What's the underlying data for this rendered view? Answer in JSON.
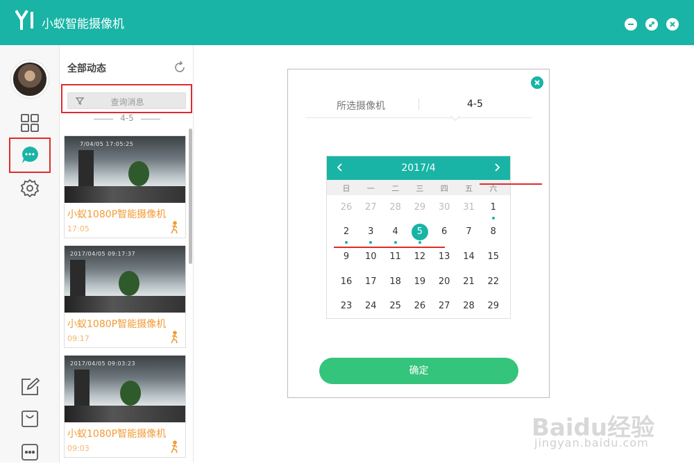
{
  "app": {
    "logo_text": "YI",
    "title": "小蚁智能摄像机"
  },
  "window": {
    "minimize": "minimize-icon",
    "restore": "restore-icon",
    "close": "close-icon"
  },
  "nav": {
    "items": [
      "grid-icon",
      "message-icon",
      "gear-icon",
      "edit-icon",
      "bag-icon",
      "more-icon"
    ]
  },
  "feed": {
    "title": "全部动态",
    "search_placeholder": "查询消息",
    "date_label": "4-5",
    "cards": [
      {
        "timestamp": "7/04/05 17:05:25",
        "name": "小蚁1080P智能摄像机",
        "time": "17:05"
      },
      {
        "timestamp": "2017/04/05 09:17:37",
        "name": "小蚁1080P智能摄像机",
        "time": "09:17"
      },
      {
        "timestamp": "2017/04/05 09:03:23",
        "name": "小蚁1080P智能摄像机",
        "time": "09:03"
      }
    ]
  },
  "dialog": {
    "tab_camera": "所选摄像机",
    "tab_date": "4-5",
    "month": "2017/4",
    "weekdays": [
      "日",
      "一",
      "二",
      "三",
      "四",
      "五",
      "六"
    ],
    "weeks": [
      [
        "26",
        "27",
        "28",
        "29",
        "30",
        "31",
        "1"
      ],
      [
        "2",
        "3",
        "4",
        "5",
        "6",
        "7",
        "8"
      ],
      [
        "9",
        "10",
        "11",
        "12",
        "13",
        "14",
        "15"
      ],
      [
        "16",
        "17",
        "18",
        "19",
        "20",
        "21",
        "22"
      ],
      [
        "23",
        "24",
        "25",
        "26",
        "27",
        "28",
        "29"
      ]
    ],
    "selected_day": "5",
    "days_with_events": [
      "1",
      "2",
      "3",
      "4",
      "5"
    ],
    "confirm": "确定"
  },
  "watermark": {
    "brand": "Baidu经验",
    "url": "jingyan.baidu.com"
  },
  "colors": {
    "accent": "#19b4a6",
    "confirm": "#34c47c",
    "highlight": "#e02a2a",
    "card_text": "#f29a35"
  }
}
